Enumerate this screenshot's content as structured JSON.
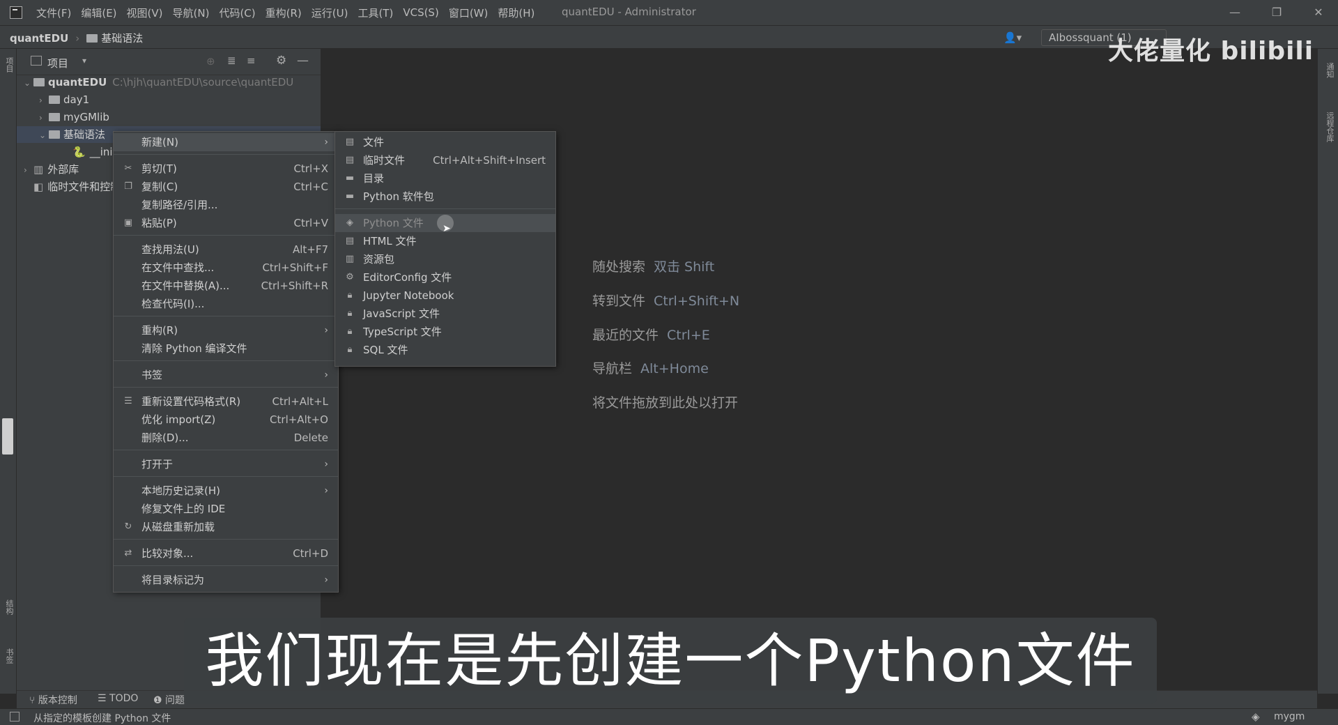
{
  "window": {
    "menu": [
      "文件(F)",
      "编辑(E)",
      "视图(V)",
      "导航(N)",
      "代码(C)",
      "重构(R)",
      "运行(U)",
      "工具(T)",
      "VCS(S)",
      "窗口(W)",
      "帮助(H)"
    ],
    "title": "quantEDU - Administrator",
    "controls": [
      "—",
      "❐",
      "✕"
    ]
  },
  "navbar": {
    "project": "quantEDU",
    "folder": "基础语法",
    "run_config": "AIbossquant (1)"
  },
  "left_tabs": [
    "项目",
    "结构",
    "书签"
  ],
  "right_tabs": [
    "通知",
    "远程仓库"
  ],
  "project_panel": {
    "title": "项目",
    "tree": [
      {
        "name": "quantEDU",
        "path": "C:\\hjh\\quantEDU\\source\\quantEDU"
      },
      {
        "name": "day1"
      },
      {
        "name": "myGMlib"
      },
      {
        "name": "基础语法"
      },
      {
        "name": "__init__.py"
      },
      {
        "name": "外部库"
      },
      {
        "name": "临时文件和控制台"
      }
    ]
  },
  "context_menu": [
    {
      "label": "新建(N)",
      "arrow": "›"
    },
    {
      "label": "剪切(T)",
      "shortcut": "Ctrl+X"
    },
    {
      "label": "复制(C)",
      "shortcut": "Ctrl+C"
    },
    {
      "label": "复制路径/引用..."
    },
    {
      "label": "粘贴(P)",
      "shortcut": "Ctrl+V"
    },
    {
      "label": "查找用法(U)",
      "shortcut": "Alt+F7"
    },
    {
      "label": "在文件中查找...",
      "shortcut": "Ctrl+Shift+F"
    },
    {
      "label": "在文件中替换(A)...",
      "shortcut": "Ctrl+Shift+R"
    },
    {
      "label": "检查代码(I)..."
    },
    {
      "label": "重构(R)",
      "arrow": "›"
    },
    {
      "label": "清除 Python 编译文件"
    },
    {
      "label": "书签",
      "arrow": "›"
    },
    {
      "label": "重新设置代码格式(R)",
      "shortcut": "Ctrl+Alt+L"
    },
    {
      "label": "优化 import(Z)",
      "shortcut": "Ctrl+Alt+O"
    },
    {
      "label": "删除(D)...",
      "shortcut": "Delete"
    },
    {
      "label": "打开于",
      "arrow": "›"
    },
    {
      "label": "本地历史记录(H)",
      "arrow": "›"
    },
    {
      "label": "修复文件上的 IDE"
    },
    {
      "label": "从磁盘重新加载"
    },
    {
      "label": "比较对象...",
      "shortcut": "Ctrl+D"
    },
    {
      "label": "将目录标记为",
      "arrow": "›"
    }
  ],
  "submenu": [
    {
      "label": "文件"
    },
    {
      "label": "临时文件",
      "shortcut": "Ctrl+Alt+Shift+Insert"
    },
    {
      "label": "目录"
    },
    {
      "label": "Python 软件包"
    },
    {
      "label": "Python 文件"
    },
    {
      "label": "HTML 文件"
    },
    {
      "label": "资源包"
    },
    {
      "label": "EditorConfig 文件"
    },
    {
      "label": "Jupyter Notebook"
    },
    {
      "label": "JavaScript 文件"
    },
    {
      "label": "TypeScript 文件"
    },
    {
      "label": "SQL 文件"
    }
  ],
  "editor_hints": [
    {
      "label": "随处搜索",
      "key": "双击 Shift"
    },
    {
      "label": "转到文件",
      "key": "Ctrl+Shift+N"
    },
    {
      "label": "最近的文件",
      "key": "Ctrl+E"
    },
    {
      "label": "导航栏",
      "key": "Alt+Home"
    },
    {
      "label": "将文件拖放到此处以打开",
      "key": ""
    }
  ],
  "toolwindows": [
    "版本控制",
    "TODO",
    "问题"
  ],
  "status": {
    "text": "从指定的模板创建 Python 文件",
    "right": "mygm"
  },
  "watermark": "大佬量化 bilibili",
  "subtitle": "我们现在是先创建一个Python文件"
}
